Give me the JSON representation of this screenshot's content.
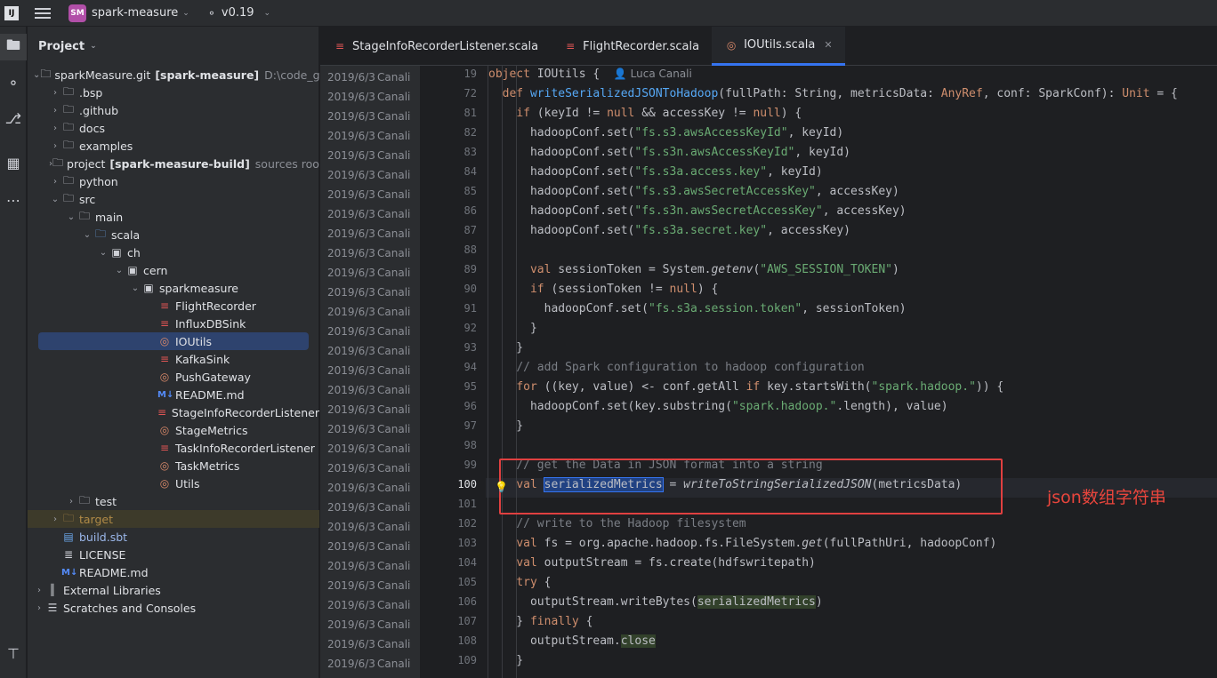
{
  "titlebar": {
    "app_icon": "IJ",
    "project_badge": "SM",
    "project_name": "spark-measure",
    "vcs_branch": "v0.19"
  },
  "project_panel": {
    "title": "Project",
    "tree": [
      {
        "label": "sparkMeasure.git",
        "bold": "[spark-measure]",
        "hint": "D:\\code_github",
        "icon": "module-folder-icon",
        "level": 0,
        "expanded": true
      },
      {
        "label": ".bsp",
        "icon": "folder-icon",
        "level": 1,
        "expanded": false
      },
      {
        "label": ".github",
        "icon": "folder-icon",
        "level": 1,
        "expanded": false
      },
      {
        "label": "docs",
        "icon": "folder-icon",
        "level": 1,
        "expanded": false
      },
      {
        "label": "examples",
        "icon": "folder-icon",
        "level": 1,
        "expanded": false
      },
      {
        "label": "project",
        "bold": "[spark-measure-build]",
        "hint": "sources root",
        "icon": "module-folder-icon",
        "level": 1,
        "expanded": false
      },
      {
        "label": "python",
        "icon": "folder-icon",
        "level": 1,
        "expanded": false
      },
      {
        "label": "src",
        "icon": "folder-icon",
        "level": 1,
        "expanded": true
      },
      {
        "label": "main",
        "icon": "folder-icon",
        "level": 2,
        "expanded": true
      },
      {
        "label": "scala",
        "icon": "source-folder-icon",
        "level": 3,
        "expanded": true
      },
      {
        "label": "ch",
        "icon": "package-icon",
        "level": 4,
        "expanded": true
      },
      {
        "label": "cern",
        "icon": "package-icon",
        "level": 5,
        "expanded": true
      },
      {
        "label": "sparkmeasure",
        "icon": "package-icon",
        "level": 6,
        "expanded": true
      },
      {
        "label": "FlightRecorder",
        "icon": "scala-class-icon",
        "level": 7
      },
      {
        "label": "InfluxDBSink",
        "icon": "scala-class-icon",
        "level": 7
      },
      {
        "label": "IOUtils",
        "icon": "scala-object-icon",
        "level": 7,
        "selected": true
      },
      {
        "label": "KafkaSink",
        "icon": "scala-class-icon",
        "level": 7
      },
      {
        "label": "PushGateway",
        "icon": "scala-object-icon",
        "level": 7
      },
      {
        "label": "README.md",
        "icon": "markdown-icon",
        "level": 7
      },
      {
        "label": "StageInfoRecorderListener",
        "icon": "scala-class-icon",
        "level": 7
      },
      {
        "label": "StageMetrics",
        "icon": "scala-object-icon",
        "level": 7
      },
      {
        "label": "TaskInfoRecorderListener",
        "icon": "scala-class-icon",
        "level": 7
      },
      {
        "label": "TaskMetrics",
        "icon": "scala-object-icon",
        "level": 7
      },
      {
        "label": "Utils",
        "icon": "scala-object-icon",
        "level": 7
      },
      {
        "label": "test",
        "icon": "folder-icon",
        "level": 2,
        "expanded": false
      },
      {
        "label": "target",
        "icon": "excluded-folder-icon",
        "level": 1,
        "expanded": false,
        "orange": true
      },
      {
        "label": "build.sbt",
        "icon": "sbt-file-icon",
        "level": 1,
        "blue": true
      },
      {
        "label": "LICENSE",
        "icon": "text-file-icon",
        "level": 1
      },
      {
        "label": "README.md",
        "icon": "markdown-icon",
        "level": 1
      },
      {
        "label": "External Libraries",
        "icon": "library-icon",
        "level": 0,
        "expanded": false
      },
      {
        "label": "Scratches and Consoles",
        "icon": "scratches-icon",
        "level": 0,
        "expanded": false
      }
    ]
  },
  "tabs": [
    {
      "label": "StageInfoRecorderListener.scala",
      "icon": "scala-class-icon",
      "active": false
    },
    {
      "label": "FlightRecorder.scala",
      "icon": "scala-class-icon",
      "active": false
    },
    {
      "label": "IOUtils.scala",
      "icon": "scala-object-icon",
      "active": true
    }
  ],
  "annotation": {
    "date": "2019/6/3",
    "author": "Canali"
  },
  "code_author_hint": "Luca Canali",
  "line_numbers": [
    "19",
    "72",
    "81",
    "82",
    "83",
    "84",
    "85",
    "86",
    "87",
    "88",
    "89",
    "90",
    "91",
    "92",
    "93",
    "94",
    "95",
    "96",
    "97",
    "98",
    "99",
    "100",
    "101",
    "102",
    "103",
    "104",
    "105",
    "106",
    "107",
    "108",
    "109"
  ],
  "current_line": "100",
  "callout_note": "json数组字符串",
  "accent_colors": {
    "selection": "#214283",
    "callout": "#e04040"
  }
}
